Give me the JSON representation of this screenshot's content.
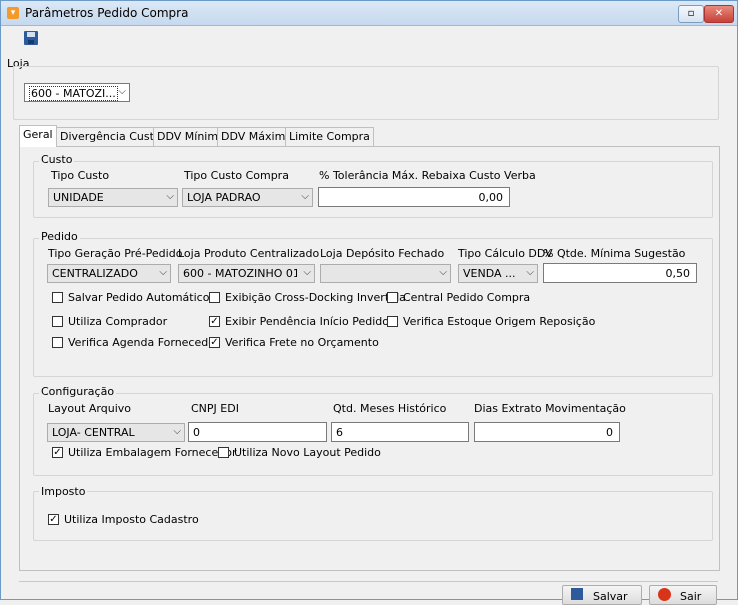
{
  "window": {
    "title": "Parâmetros Pedido Compra"
  },
  "loja": {
    "label": "Loja",
    "value": "600 - MATOZI..."
  },
  "tabs": [
    "Geral",
    "Divergência Custo",
    "DDV Mínimo",
    "DDV Máximo",
    "Limite Compra"
  ],
  "custo": {
    "title": "Custo",
    "tipo_custo_label": "Tipo Custo",
    "tipo_custo_value": "UNIDADE",
    "tipo_custo_compra_label": "Tipo Custo Compra",
    "tipo_custo_compra_value": "LOJA PADRAO",
    "tolerancia_label": "% Tolerância Máx. Rebaixa Custo Verba",
    "tolerancia_value": "0,00"
  },
  "pedido": {
    "title": "Pedido",
    "tipo_geracao_label": "Tipo Geração Pré-Pedido",
    "tipo_geracao_value": "CENTRALIZADO",
    "loja_produto_label": "Loja Produto Centralizado",
    "loja_produto_value": "600 - MATOZINHO 01",
    "loja_deposito_label": "Loja Depósito Fechado",
    "loja_deposito_value": "",
    "tipo_calculo_label": "Tipo Cálculo DDV",
    "tipo_calculo_value": "VENDA ...",
    "qtde_minima_label": "% Qtde. Mínima Sugestão",
    "qtde_minima_value": "0,50",
    "checks": [
      {
        "label": "Salvar Pedido Automático",
        "checked": false
      },
      {
        "label": "Exibição Cross-Docking Invertida",
        "checked": false
      },
      {
        "label": "Central Pedido Compra",
        "checked": false
      },
      {
        "label": "Utiliza Comprador",
        "checked": false
      },
      {
        "label": "Exibir Pendência Início Pedido",
        "checked": true
      },
      {
        "label": "Verifica Estoque Origem Reposição",
        "checked": false
      },
      {
        "label": "Verifica Agenda Fornecedor",
        "checked": false
      },
      {
        "label": "Verifica Frete no Orçamento",
        "checked": true
      }
    ]
  },
  "configuracao": {
    "title": "Configuração",
    "layout_label": "Layout Arquivo",
    "layout_value": "LOJA- CENTRAL",
    "cnpj_label": "CNPJ EDI",
    "cnpj_value": "0",
    "qtd_meses_label": "Qtd. Meses Histórico",
    "qtd_meses_value": "6",
    "dias_extrato_label": "Dias Extrato Movimentação",
    "dias_extrato_value": "0",
    "checks": [
      {
        "label": "Utiliza Embalagem Fornecedor",
        "checked": true
      },
      {
        "label": "Utiliza Novo Layout Pedido",
        "checked": false
      }
    ]
  },
  "imposto": {
    "title": "Imposto",
    "checks": [
      {
        "label": "Utiliza Imposto Cadastro",
        "checked": true
      }
    ]
  },
  "buttons": {
    "salvar": "Salvar",
    "sair": "Sair"
  },
  "colors": {
    "title_icon": "#f39a2b",
    "close_button": "#c7413a",
    "exit_icon": "#d9341a"
  }
}
